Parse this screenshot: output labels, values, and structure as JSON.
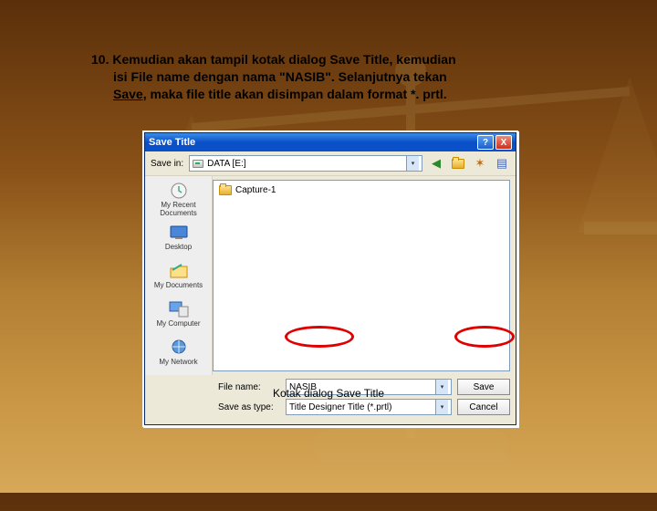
{
  "instruction": {
    "line1": "10. Kemudian akan tampil kotak dialog Save Title, kemudian",
    "line2": "isi File name dengan nama \"NASIB\". Selanjutnya tekan",
    "line3_a": "Save",
    "line3_b": ", maka file title akan disimpan dalam format *. prtl."
  },
  "dialog": {
    "title": "Save Title",
    "help": "?",
    "close": "X",
    "savein_label": "Save in:",
    "savein_value": "DATA [E:]",
    "folder_item": "Capture-1",
    "filename_label": "File name:",
    "filename_value": "NASIB",
    "saveastype_label": "Save as type:",
    "saveastype_value": "Title Designer Title (*.prtl)",
    "save_btn": "Save",
    "cancel_btn": "Cancel"
  },
  "places": [
    "My Recent Documents",
    "Desktop",
    "My Documents",
    "My Computer",
    "My Network"
  ],
  "caption": "Kotak dialog Save Title"
}
